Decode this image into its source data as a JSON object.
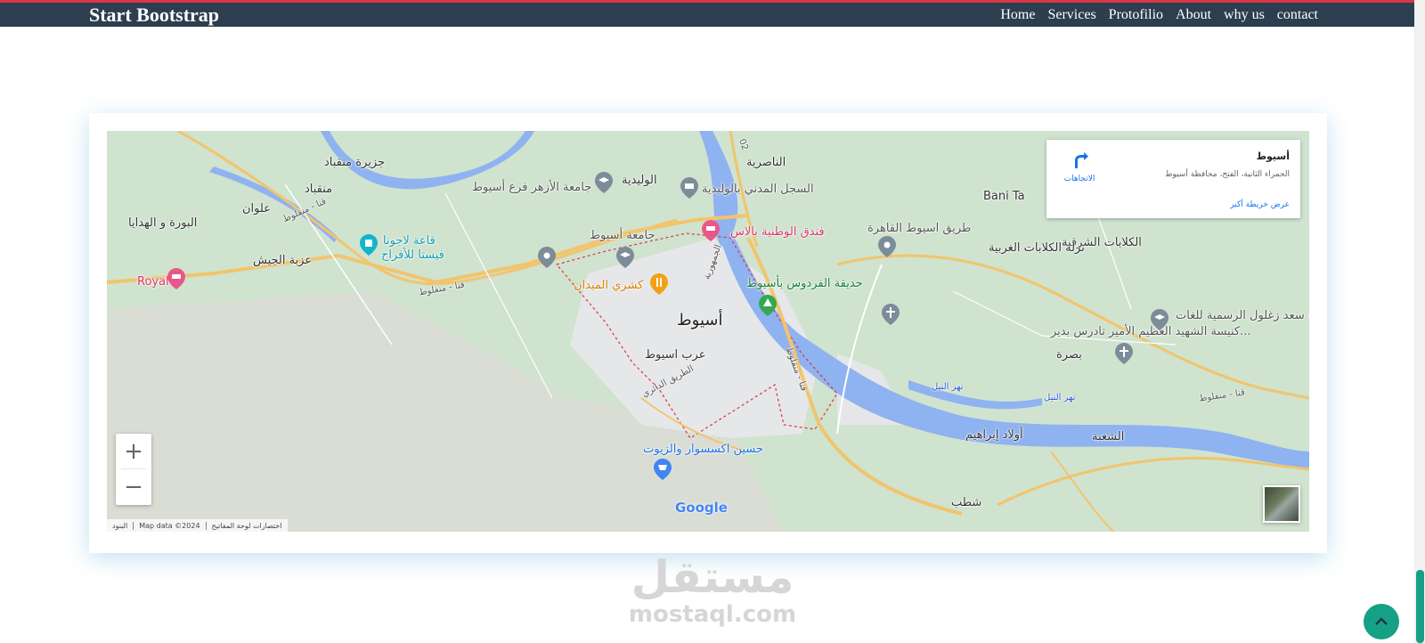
{
  "navbar": {
    "brand": "Start Bootstrap",
    "links": [
      {
        "label": "Home"
      },
      {
        "label": "Services"
      },
      {
        "label": "Protofilio"
      },
      {
        "label": "About"
      },
      {
        "label": "why us"
      },
      {
        "label": "contact"
      }
    ]
  },
  "colors": {
    "navbar_bg": "#2c3e50",
    "navbar_top_border": "#dc3545",
    "accent": "#16a085",
    "map_land": "#cfe3cf",
    "map_water": "#8fb2f0",
    "map_road": "#f2c46d"
  },
  "map": {
    "labels": {
      "city_main": "أسيوط",
      "gharb_assiut": "عرب اسيوط",
      "manqabad": "منقباد",
      "gezeret_manqabad": "جزيرة منقباد",
      "elwan": "علوان",
      "bora": "البورة و الهدايا",
      "ezbet_gaysh": "عزبة الجيش",
      "royal": "Royal",
      "nasreya": "الناصرية",
      "walideya": "الوليدية",
      "azhar": "جامعة الأزهر فرع أسيوط",
      "madani": "السجل المدني بالوليدية",
      "fayrouz": "فيستا للأفراح",
      "qaat": "قاعة لاجونا",
      "assiut_uni": "جامعة أسيوط",
      "hotel": "فندق الوطنية بالاس",
      "koshary": "كشري الميدان",
      "ferdous": "حديقة الفردوس بأسيوط",
      "cairo_road": "طريق اسيوط القاهرة",
      "bani_ta": "Bani Ta",
      "kalabat_sharq": "الكلابات الشرقية",
      "kalabat_gharb": "نزلة الكلابات الغربية",
      "saad_school": "مدرسة سعد زغلول الرسمية للغات",
      "church": "كنيسة الشهيد العظيم الأمير تادرس بدير...",
      "basra": "بصرة",
      "nile1": "نهر النيل",
      "nile2": "نهر النيل",
      "awlad_ibrahim": "أولاد إبراهيم",
      "shaghba": "الشغبة",
      "shotb": "شطب",
      "hussein": "حسين اكسسوار والزيوت",
      "ring_road": "الطريق الدائري",
      "qena_road_1": "قنا - منفلوط",
      "qena_road_2": "قنا - منفلوط",
      "qena_road_3": "قنا - منفلوط",
      "qena_road_4": "قنا - منفلوط",
      "gomhoreya": "الجمهورية",
      "road_02": "02"
    },
    "info_box": {
      "title": "أسيوط",
      "address": "الحمراء الثانية، الفتح، محافظة أسيوط",
      "directions": "الاتجاهات",
      "larger_map": "عرض خريطة أكبر"
    },
    "zoom_in": "+",
    "zoom_out": "−",
    "google": "Google",
    "attribution": {
      "shortcuts": "اختصارات لوحة المفاتيح",
      "map_data": "Map data ©2024",
      "terms": "البنود"
    }
  },
  "watermark": {
    "arabic": "مستقل",
    "latin": "mostaql.com"
  }
}
